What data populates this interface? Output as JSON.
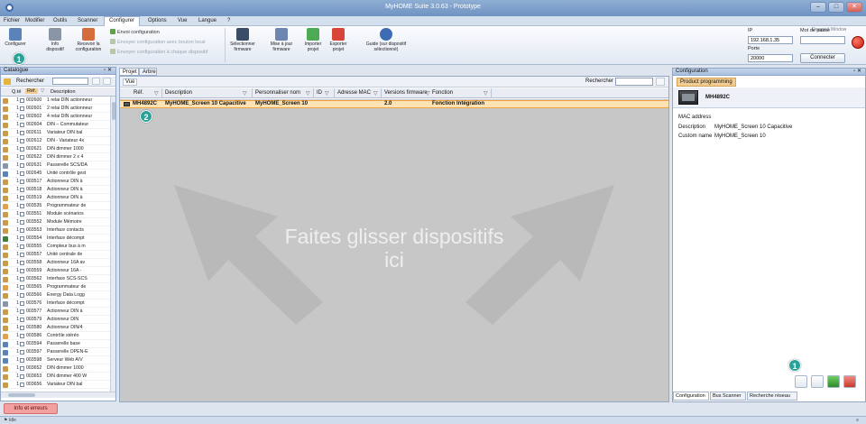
{
  "window": {
    "title": "MyHOME Suite 3.0.63 - Prototype",
    "controls": [
      "–",
      "□",
      "✕"
    ]
  },
  "menu": {
    "items": [
      "Fichier",
      "Modifier",
      "Outils",
      "Scanner",
      "Configurer",
      "Options",
      "Vue",
      "Langue",
      "?"
    ],
    "active": "Configurer"
  },
  "ribbon": {
    "buttons": [
      {
        "label": "Configurer",
        "icon": "configure-icon"
      },
      {
        "label": "Info dispositif",
        "icon": "info-device-icon"
      },
      {
        "label": "Recevoir la configuration",
        "icon": "receive-config-icon"
      },
      {
        "label": "Sélectionner firmware",
        "icon": "select-firmware-icon"
      },
      {
        "label": "Mise à jour firmware",
        "icon": "update-firmware-icon"
      },
      {
        "label": "Importer projet",
        "icon": "import-project-icon"
      },
      {
        "label": "Exporter projet",
        "icon": "export-project-icon"
      },
      {
        "label": "Guide (sur dispositif sélectionné)",
        "icon": "help-icon"
      }
    ],
    "send_options": [
      "Envoi configuration",
      "Envoyer configuration avec bouton local",
      "Envoyer configuration à chaque dispositif"
    ],
    "top_right_hint": "Dragged Window"
  },
  "connection": {
    "ip_label": "IP",
    "ip": "192.168.1.35",
    "port_label": "Porte",
    "port": "20000",
    "password_label": "Mot de passe",
    "password": "",
    "connect": "Connecter"
  },
  "catalogue": {
    "title": "Catalogue",
    "controls": "▫ ✕",
    "search_label": "Rechercher",
    "columns": [
      "Q.té",
      "Réf.",
      "Description"
    ],
    "rows": [
      {
        "qty": "1",
        "ref": "002600",
        "desc": "1 relai DIN actionneur"
      },
      {
        "qty": "1",
        "ref": "002601",
        "desc": "2 relai DIN actionneur"
      },
      {
        "qty": "1",
        "ref": "002602",
        "desc": "4 relai DIN actionneur"
      },
      {
        "qty": "1",
        "ref": "002604",
        "desc": "DIN – Commutateur"
      },
      {
        "qty": "1",
        "ref": "002611",
        "desc": "Variateur DIN bal"
      },
      {
        "qty": "1",
        "ref": "002612",
        "desc": "DIN - Variateur 4x"
      },
      {
        "qty": "1",
        "ref": "002621",
        "desc": "DIN dimmer 1000"
      },
      {
        "qty": "1",
        "ref": "002622",
        "desc": "DIN dimmer 2 x 4"
      },
      {
        "qty": "1",
        "ref": "002631",
        "desc": "Passerelle SCS/DA"
      },
      {
        "qty": "1",
        "ref": "002645",
        "desc": "Unité contrôle gest"
      },
      {
        "qty": "1",
        "ref": "003517",
        "desc": "Actionneur DIN à"
      },
      {
        "qty": "1",
        "ref": "003518",
        "desc": "Actionneur DIN à"
      },
      {
        "qty": "1",
        "ref": "003519",
        "desc": "Actionneur DIN à"
      },
      {
        "qty": "1",
        "ref": "003535",
        "desc": "Programmateur de"
      },
      {
        "qty": "1",
        "ref": "003551",
        "desc": "Module scénarios"
      },
      {
        "qty": "1",
        "ref": "003552",
        "desc": "Module Mémoire"
      },
      {
        "qty": "1",
        "ref": "003553",
        "desc": "Interface contacts"
      },
      {
        "qty": "1",
        "ref": "003554",
        "desc": "Interface décompt"
      },
      {
        "qty": "1",
        "ref": "003555",
        "desc": "Compteur bus à m"
      },
      {
        "qty": "1",
        "ref": "003557",
        "desc": "Unité centrale de"
      },
      {
        "qty": "1",
        "ref": "003558",
        "desc": "Actionneur 16A av"
      },
      {
        "qty": "1",
        "ref": "003559",
        "desc": "Actionneur 16A -"
      },
      {
        "qty": "1",
        "ref": "003562",
        "desc": "Interface SCS-SCS"
      },
      {
        "qty": "1",
        "ref": "003565",
        "desc": "Programmateur de"
      },
      {
        "qty": "1",
        "ref": "003566",
        "desc": "Energy Data Logg"
      },
      {
        "qty": "1",
        "ref": "003576",
        "desc": "Interface décompt"
      },
      {
        "qty": "1",
        "ref": "003577",
        "desc": "Actionneur DIN à"
      },
      {
        "qty": "1",
        "ref": "003579",
        "desc": "Actionneur DIN"
      },
      {
        "qty": "1",
        "ref": "003580",
        "desc": "Actionneur DIN/4"
      },
      {
        "qty": "1",
        "ref": "003586",
        "desc": "Contrôle stéréo"
      },
      {
        "qty": "1",
        "ref": "003594",
        "desc": "Passerelle base"
      },
      {
        "qty": "1",
        "ref": "003597",
        "desc": "Passerelle OPEN-E"
      },
      {
        "qty": "1",
        "ref": "003598",
        "desc": "Serveur Web A/V"
      },
      {
        "qty": "1",
        "ref": "003652",
        "desc": "DIN dimmer 1000"
      },
      {
        "qty": "1",
        "ref": "003653",
        "desc": "DIN dimmer 400 W"
      },
      {
        "qty": "1",
        "ref": "003656",
        "desc": "Variateur DIN bal"
      }
    ]
  },
  "project": {
    "tabs": [
      "Projet",
      "Arbre"
    ],
    "view_label": "Vue",
    "search_label": "Rechercher",
    "columns": [
      "Réf.",
      "Description",
      "Personnaliser nom",
      "ID",
      "Adresse MAC",
      "Versions firmware",
      "Fonction"
    ],
    "rows": [
      {
        "ref": "MH4892C",
        "description": "MyHOME_Screen 10 Capacitive",
        "name": "MyHOME_Screen 10",
        "id": "",
        "mac": "",
        "firmware": "2.0",
        "function": "Fonction Intégration"
      }
    ],
    "drop_text_1": "Faites glisser dispositifs",
    "drop_text_2": "ici"
  },
  "configuration": {
    "title": "Configuration",
    "controls": "▫ ✕",
    "subtab": "Product programming",
    "device": "MH4892C",
    "props": [
      {
        "label": "MAC address",
        "value": ""
      },
      {
        "label": "Description",
        "value": "MyHOME_Screen 10 Capacitive"
      },
      {
        "label": "Custom name",
        "value": "MyHOME_Screen 10"
      }
    ],
    "bottom_tabs": [
      "Configuration",
      "Bus Scanner",
      "Recherche réseau"
    ]
  },
  "badges": [
    "1",
    "2",
    "1"
  ],
  "info_button": "Info et erreurs",
  "status": {
    "left": "⚑ Idle",
    "center": "",
    "right": "≡"
  }
}
